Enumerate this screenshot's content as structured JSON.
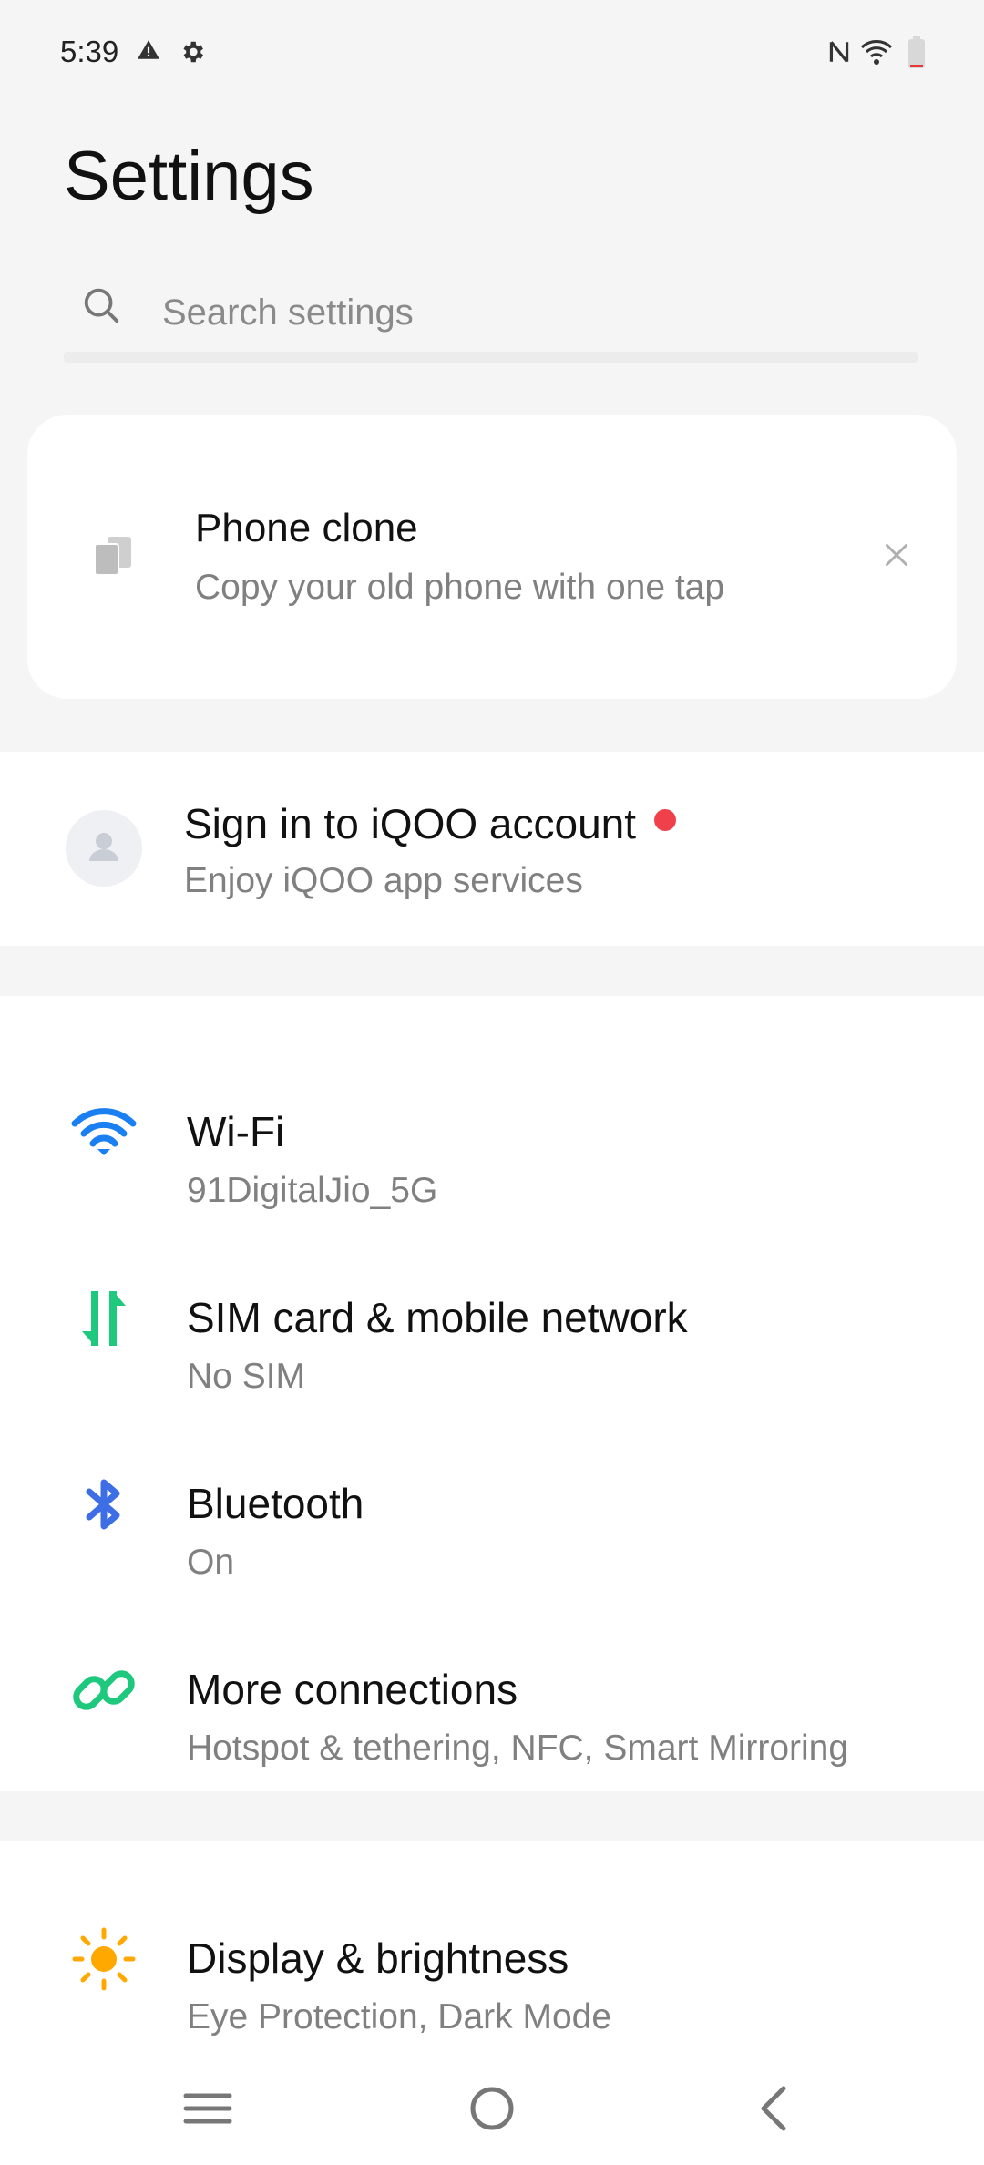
{
  "status_bar": {
    "time": "5:39"
  },
  "page": {
    "title": "Settings"
  },
  "search": {
    "placeholder": "Search settings"
  },
  "phone_clone": {
    "title": "Phone clone",
    "subtitle": "Copy your old phone with one tap"
  },
  "account": {
    "title": "Sign in to iQOO account",
    "subtitle": "Enjoy iQOO app services",
    "dot_color": "#f0404b"
  },
  "connections": [
    {
      "title": "Wi-Fi",
      "subtitle": "91DigitalJio_5G",
      "icon": "wifi-icon",
      "color": "#1a7ff0"
    },
    {
      "title": "SIM card & mobile network",
      "subtitle": "No SIM",
      "icon": "sim-network-icon",
      "color": "#1ec97e"
    },
    {
      "title": "Bluetooth",
      "subtitle": "On",
      "icon": "bluetooth-icon",
      "color": "#3d6ee6"
    },
    {
      "title": "More connections",
      "subtitle": "Hotspot & tethering, NFC, Smart Mirroring",
      "icon": "link-icon",
      "color": "#1ec97e"
    }
  ],
  "display": {
    "title": "Display & brightness",
    "subtitle": "Eye Protection, Dark Mode",
    "icon": "sun-icon",
    "color": "#ffa800"
  },
  "navigation": [
    "menu-icon",
    "home-icon",
    "back-icon"
  ]
}
